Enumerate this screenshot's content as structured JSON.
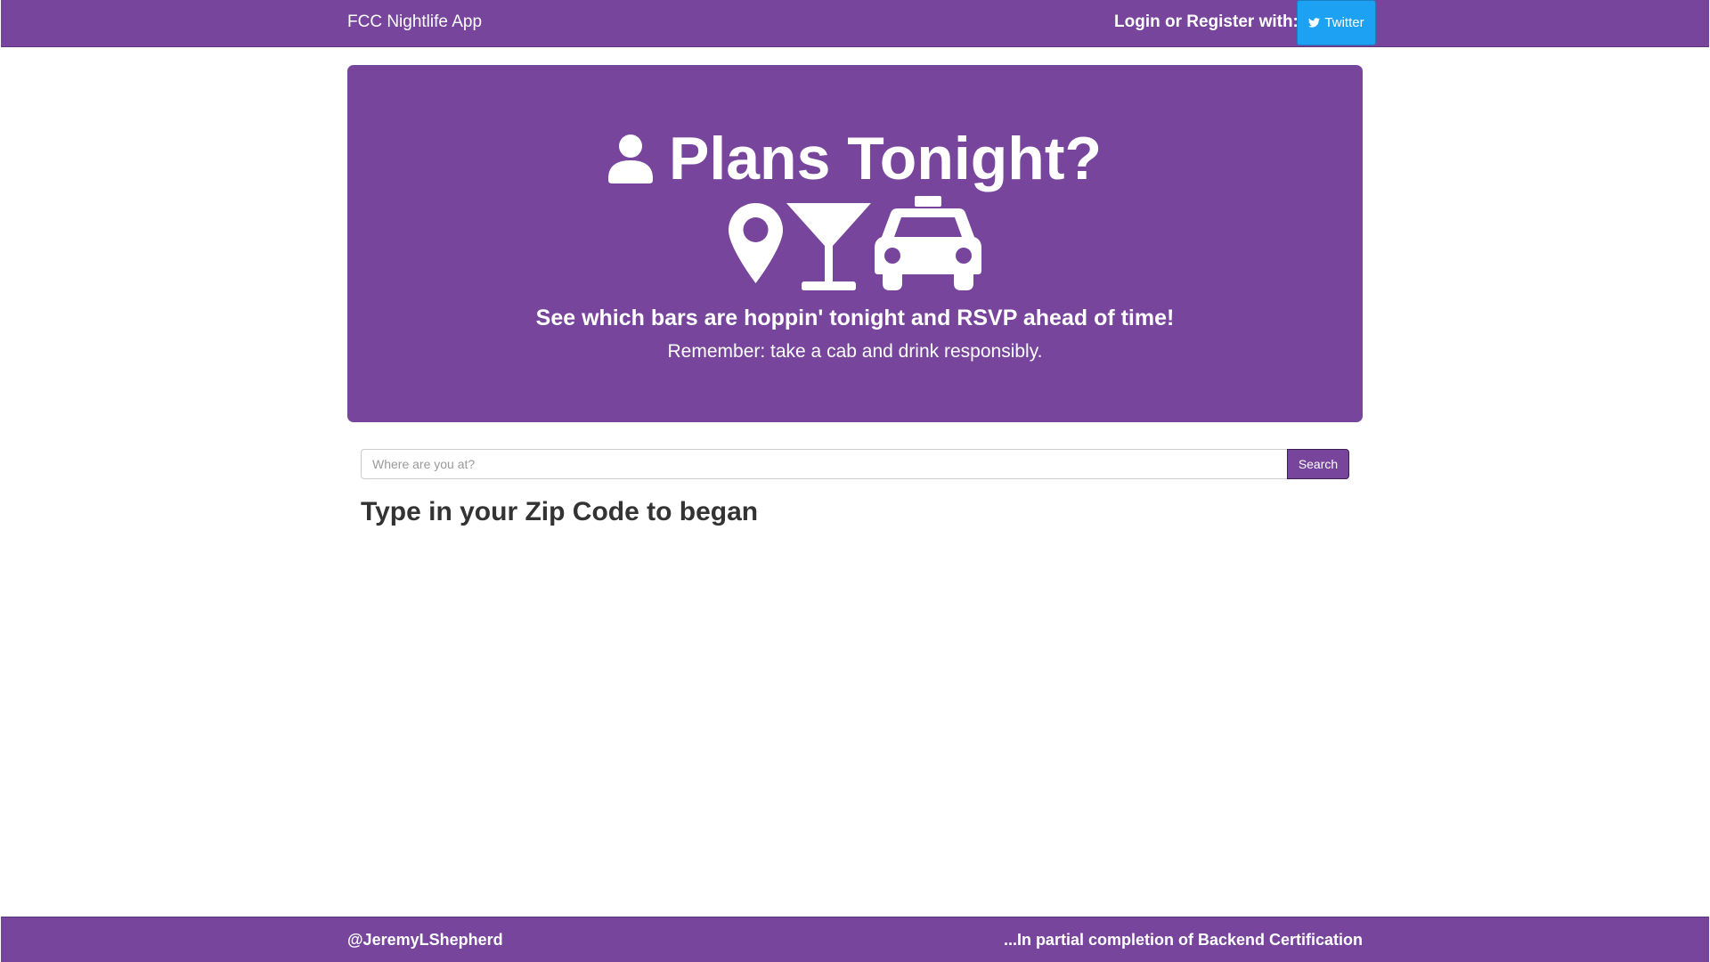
{
  "navbar": {
    "brand": "FCC Nightlife App",
    "login_text": "Login or Register with:",
    "twitter_button": {
      "label": "Twitter",
      "icon": "twitter-bird-icon",
      "color": "#1da1f2"
    }
  },
  "jumbotron": {
    "title": "Plans Tonight?",
    "title_icon": "user-icon",
    "icons": [
      "map-marker-icon",
      "cocktail-glass-icon",
      "taxi-icon"
    ],
    "tagline": "See which bars are hoppin' tonight and RSVP ahead of time!",
    "reminder": "Remember: take a cab and drink responsibly."
  },
  "search": {
    "placeholder": "Where are you at?",
    "value": "",
    "button_label": "Search"
  },
  "main": {
    "prompt": "Type in your Zip Code to began"
  },
  "footer": {
    "left": "@JeremyLShepherd",
    "right": "...In partial completion of Backend Certification"
  },
  "colors": {
    "brand_purple": "#77459c",
    "twitter_blue": "#1da1f2",
    "heading_text": "#333333"
  }
}
